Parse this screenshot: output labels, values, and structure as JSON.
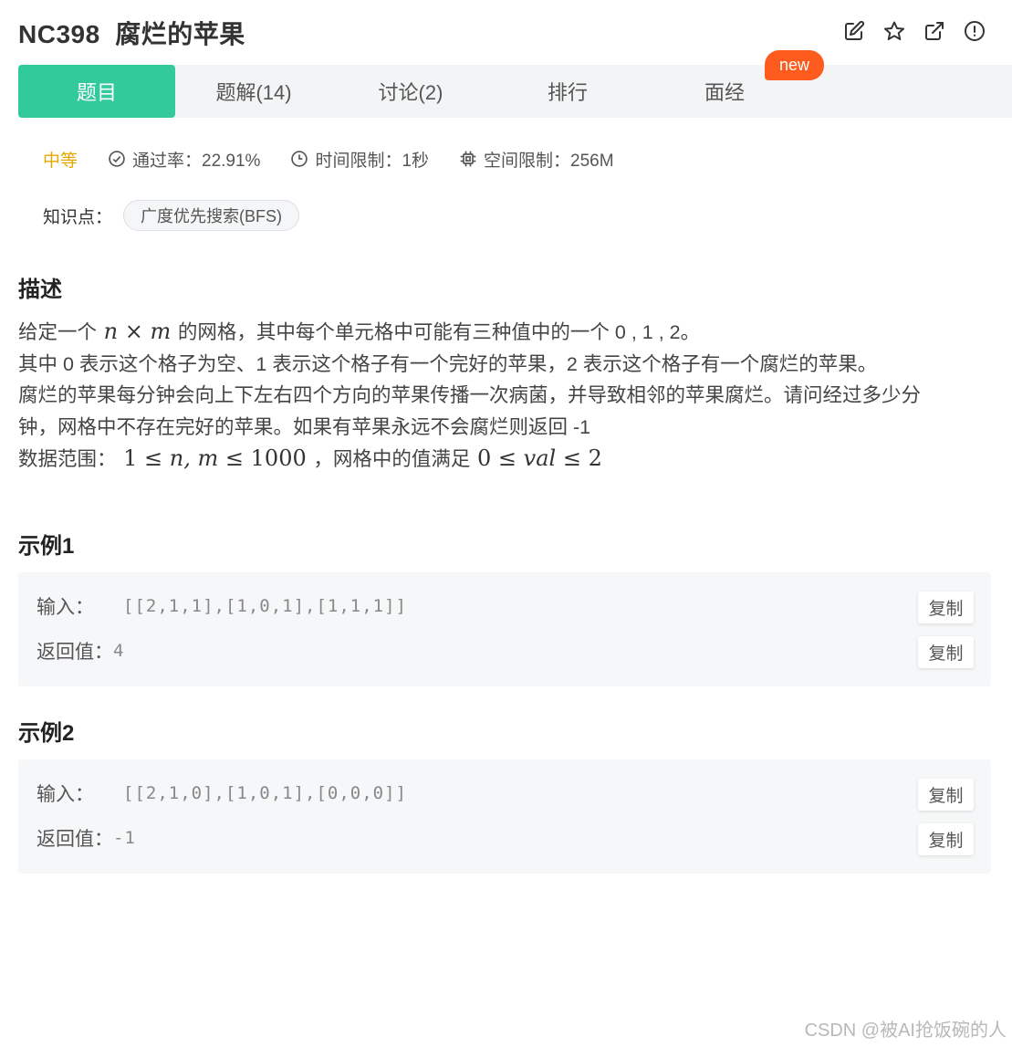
{
  "header": {
    "title": "NC398  腐烂的苹果",
    "icons": [
      "edit-icon",
      "star-icon",
      "external-link-icon",
      "report-icon"
    ]
  },
  "tabs": [
    {
      "label": "题目",
      "active": true
    },
    {
      "label": "题解(14)"
    },
    {
      "label": "讨论(2)"
    },
    {
      "label": "排行"
    },
    {
      "label": "面经"
    }
  ],
  "new_badge": "new",
  "meta": {
    "difficulty": "中等",
    "pass_rate": "通过率：22.91%",
    "time_limit": "时间限制：1秒",
    "space_limit": "空间限制：256M"
  },
  "knowledge": {
    "label": "知识点：",
    "tag": "广度优先搜索(BFS)"
  },
  "description": {
    "title": "描述",
    "line1_pre": "给定一个",
    "line1_math_n": "n",
    "line1_math_times": "×",
    "line1_math_m": "m",
    "line1_post": "的网格，其中每个单元格中可能有三种值中的一个 0 , 1 , 2。",
    "line2": "其中 0 表示这个格子为空、1 表示这个格子有一个完好的苹果，2 表示这个格子有一个腐烂的苹果。",
    "line3": "腐烂的苹果每分钟会向上下左右四个方向的苹果传播一次病菌，并导致相邻的苹果腐烂。请问经过多少分",
    "line4": "钟，网格中不存在完好的苹果。如果有苹果永远不会腐烂则返回 -1",
    "line5_pre": "数据范围：",
    "line5_math1": "1 ≤ ",
    "line5_math1_vars": "n, m",
    "line5_math1_end": " ≤ 1000",
    "line5_mid": "，网格中的值满足",
    "line5_math2_start": "0 ≤ ",
    "line5_math2_var": "val",
    "line5_math2_end": " ≤ 2"
  },
  "examples": [
    {
      "title": "示例1",
      "input_label": "输入：",
      "input_value": "[[2,1,1],[1,0,1],[1,1,1]]",
      "output_label": "返回值：",
      "output_value": "4",
      "copy_label": "复制"
    },
    {
      "title": "示例2",
      "input_label": "输入：",
      "input_value": "[[2,1,0],[1,0,1],[0,0,0]]",
      "output_label": "返回值：",
      "output_value": "-1",
      "copy_label": "复制"
    }
  ],
  "watermark": "CSDN @被AI抢饭碗的人"
}
